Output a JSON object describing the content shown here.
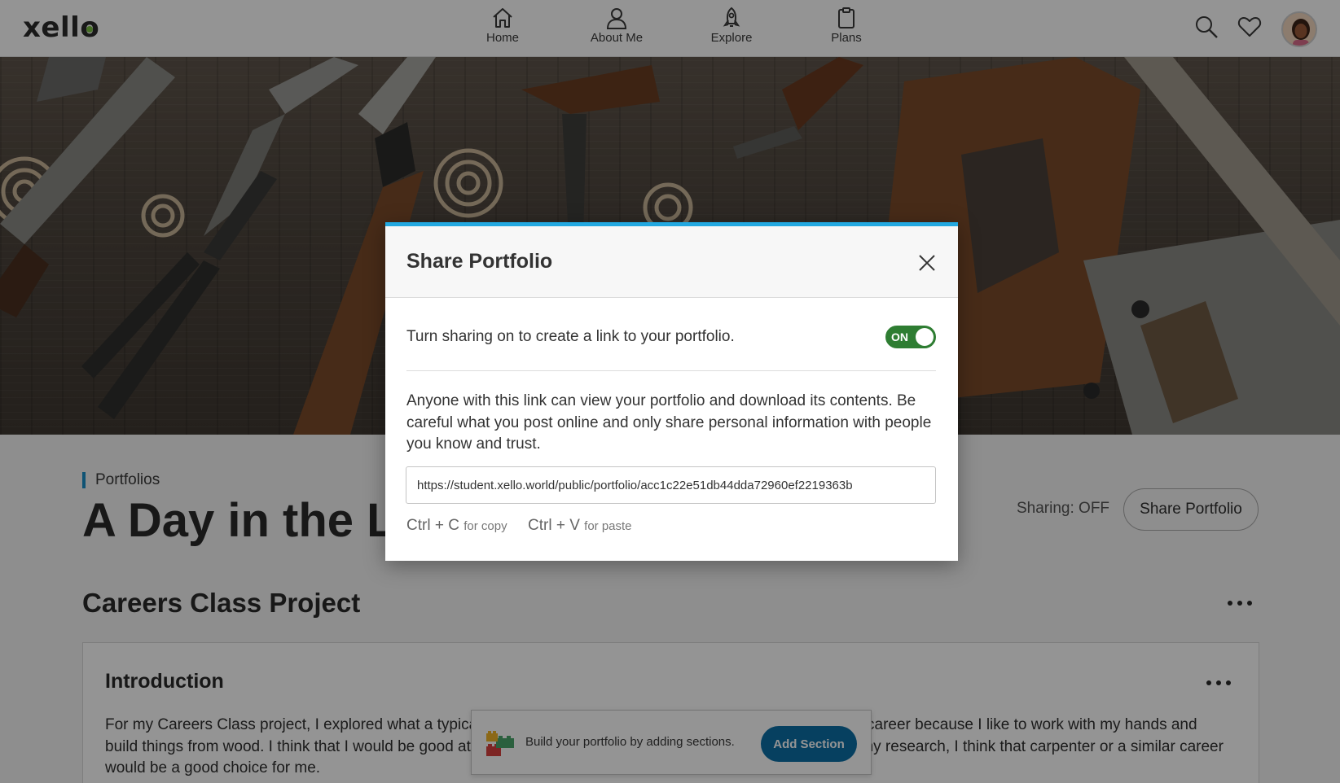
{
  "header": {
    "logo": "xello",
    "nav": [
      {
        "label": "Home",
        "icon": "home-icon"
      },
      {
        "label": "About Me",
        "icon": "person-icon"
      },
      {
        "label": "Explore",
        "icon": "rocket-icon"
      },
      {
        "label": "Plans",
        "icon": "clipboard-icon"
      }
    ],
    "icons": [
      "search-icon",
      "heart-icon",
      "avatar"
    ]
  },
  "page": {
    "breadcrumb": "Portfolios",
    "title": "A Day in the Life of a Carpenter",
    "sharing_status": "Sharing: OFF",
    "share_button": "Share Portfolio",
    "section_title": "Careers Class Project",
    "card": {
      "title": "Introduction",
      "text": "For my Careers Class project, I explored what a typical day might look like for a carpenter. I'm interested in this career because I like to work with my hands and build things from wood. I think that I would be good at it because I have good problem-solving skills. Based on my research, I think that carpenter or a similar career would be a good choice for me."
    }
  },
  "toast": {
    "text": "Build your portfolio by adding sections.",
    "button": "Add Section"
  },
  "modal": {
    "title": "Share Portfolio",
    "toggle_text": "Turn sharing on to create a link to your portfolio.",
    "toggle_state": "ON",
    "info": "Anyone with this link can view your portfolio and download its contents. Be careful what you post online and only share personal information with people you know and trust.",
    "link": "https://student.xello.world/public/portfolio/acc1c22e51db44dda72960ef2219363b",
    "copy_key": "Ctrl + C",
    "copy_hint": "for copy",
    "paste_key": "Ctrl + V",
    "paste_hint": "for paste"
  },
  "colors": {
    "accent": "#22a8e0",
    "toggle_on": "#2e7d32",
    "button_primary": "#0c6fa6",
    "logo_dot": "#7ac143"
  }
}
